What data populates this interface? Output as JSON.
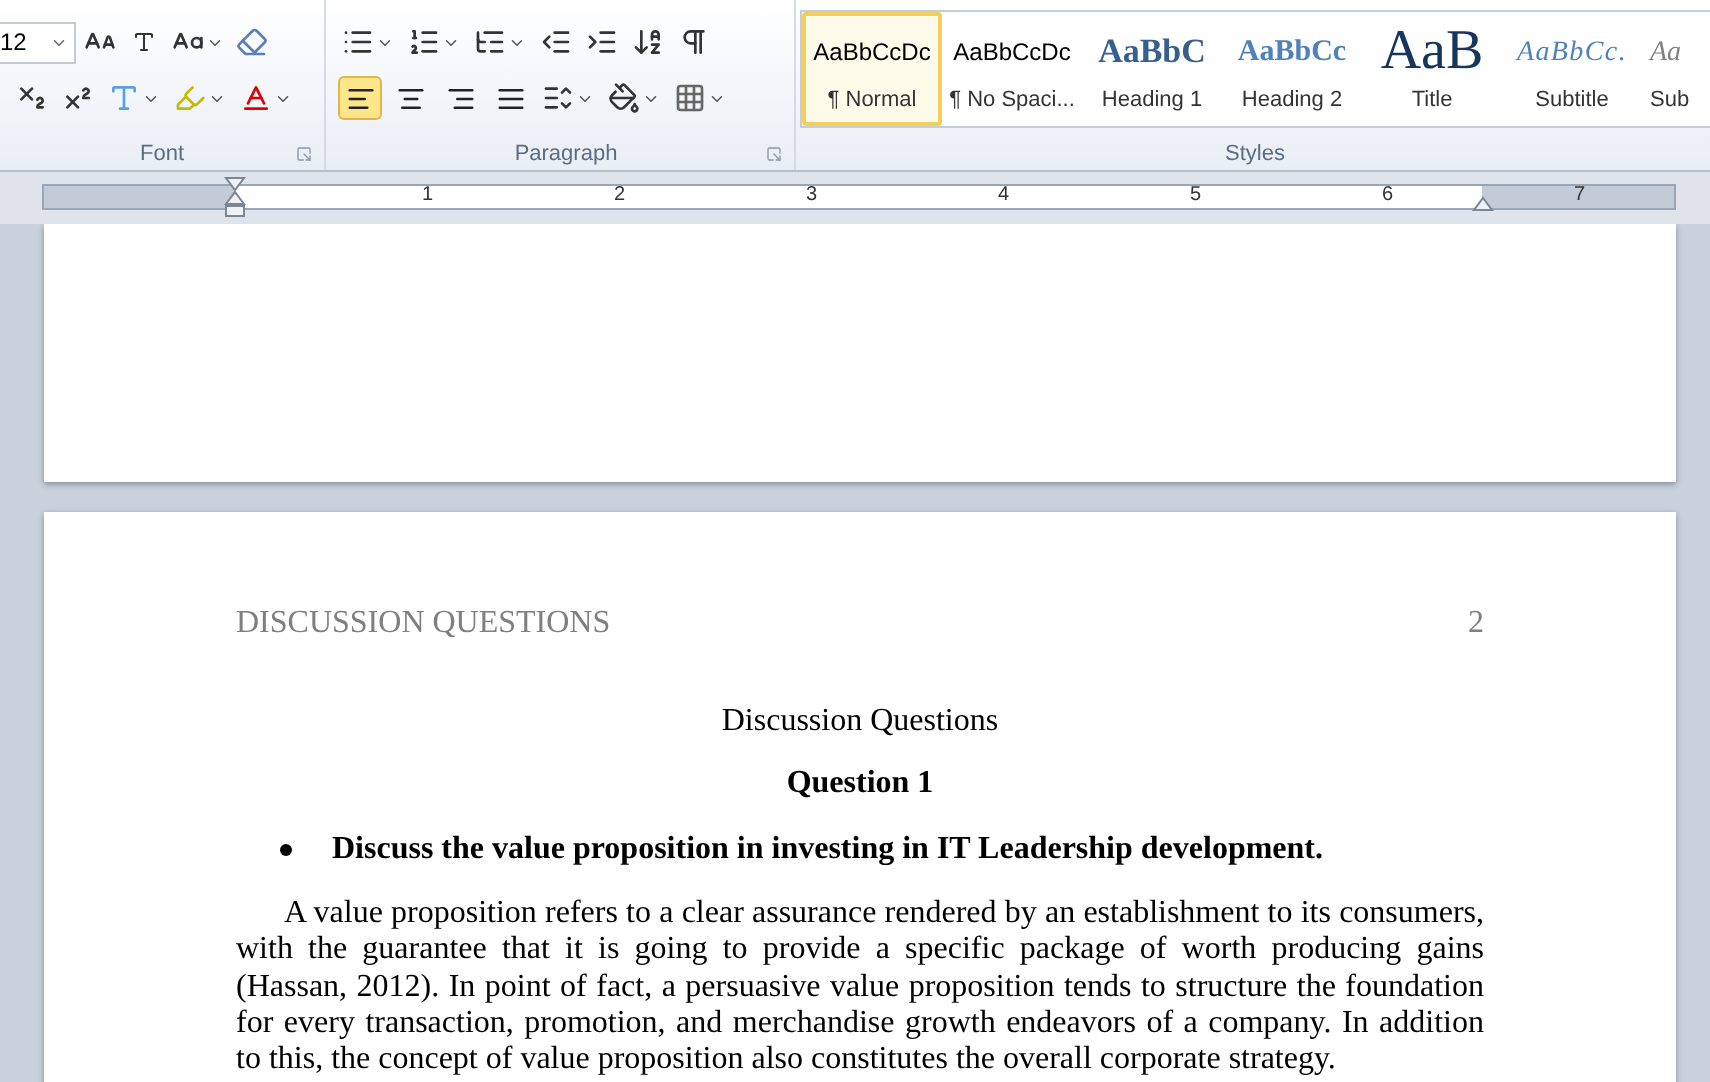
{
  "ribbon": {
    "font_group": {
      "label": "Font",
      "font_size": "12"
    },
    "paragraph_group": {
      "label": "Paragraph",
      "align": [
        {
          "kind": "left",
          "selected": true
        },
        {
          "kind": "center",
          "selected": false
        },
        {
          "kind": "right",
          "selected": false
        },
        {
          "kind": "justify",
          "selected": false
        }
      ]
    },
    "styles_group": {
      "label": "Styles",
      "styles": [
        {
          "kind": "normal",
          "preview": "AaBbCcDc",
          "name": "¶ Normal",
          "selected": true
        },
        {
          "kind": "nospacing",
          "preview": "AaBbCcDc",
          "name": "¶ No Spaci...",
          "selected": false
        },
        {
          "kind": "heading1",
          "preview": "AaBbC",
          "name": "Heading 1",
          "selected": false
        },
        {
          "kind": "heading2",
          "preview": "AaBbCc",
          "name": "Heading 2",
          "selected": false
        },
        {
          "kind": "title",
          "preview": "AaB",
          "name": "Title",
          "selected": false
        },
        {
          "kind": "subtitle",
          "preview": "AaBbCc.",
          "name": "Subtitle",
          "selected": false
        },
        {
          "kind": "subtle",
          "preview": "Aa",
          "name": "Sub",
          "selected": false
        }
      ]
    }
  },
  "ruler": {
    "numbers": [
      "1",
      "2",
      "3",
      "4",
      "5",
      "6",
      "7"
    ]
  },
  "page": {
    "header": "DISCUSSION QUESTIONS",
    "page_number": "2",
    "title": "Discussion Questions",
    "subtitle": "Question 1",
    "bullet": "Discuss the value proposition in investing in IT Leadership development.",
    "paragraph": "A value proposition refers to a clear assurance rendered by an establishment to its consumers, with the guarantee that it is going to provide a specific package of worth producing gains (Hassan, 2012). In point of fact, a persuasive value proposition tends to structure the foundation for every transaction, promotion, and merchandise growth endeavors of a company. In addition to this, the concept of value proposition also constitutes the overall corporate strategy."
  }
}
